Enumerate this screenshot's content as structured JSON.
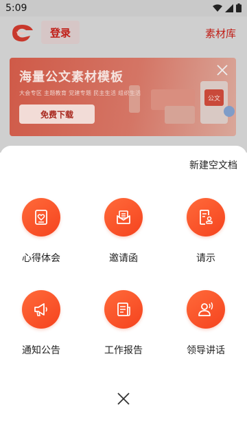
{
  "status_bar": {
    "time": "5:09"
  },
  "header": {
    "login_label": "登录",
    "library_label": "素材库"
  },
  "banner": {
    "title": "海量公文素材模板",
    "subtitle": "大会专区  主题教育  党建专题  民主生活  组织生活",
    "download_label": "免费下载",
    "doc_badge": "公文"
  },
  "sheet": {
    "new_doc_label": "新建空文档",
    "items": [
      {
        "label": "心得体会",
        "icon": "heart-note-icon"
      },
      {
        "label": "邀请函",
        "icon": "envelope-icon"
      },
      {
        "label": "请示",
        "icon": "document-stamp-icon"
      },
      {
        "label": "通知公告",
        "icon": "megaphone-icon"
      },
      {
        "label": "工作报告",
        "icon": "report-icon"
      },
      {
        "label": "领导讲话",
        "icon": "speaker-person-icon"
      }
    ]
  },
  "colors": {
    "accent": "#f5431e",
    "brand_red": "#c01d16"
  }
}
